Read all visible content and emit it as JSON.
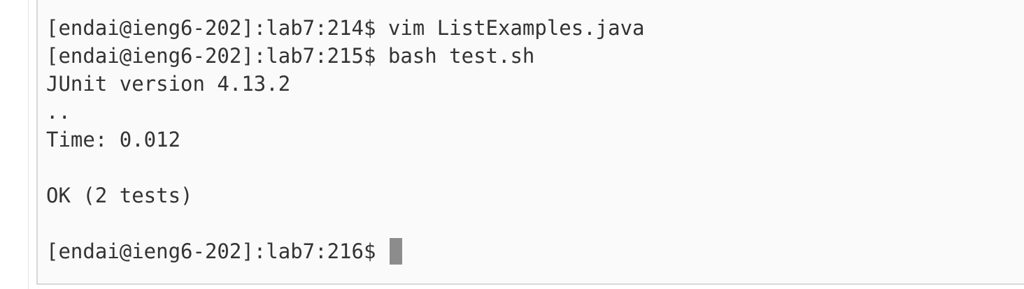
{
  "terminal": {
    "lines": [
      "[endai@ieng6-202]:lab7:214$ vim ListExamples.java",
      "[endai@ieng6-202]:lab7:215$ bash test.sh",
      "JUnit version 4.13.2",
      "..",
      "Time: 0.012",
      "",
      "OK (2 tests)",
      "",
      "[endai@ieng6-202]:lab7:216$"
    ]
  }
}
